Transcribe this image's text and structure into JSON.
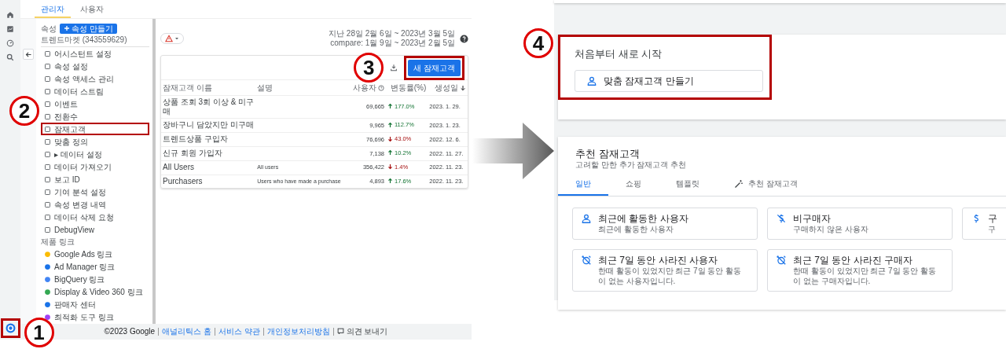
{
  "left": {
    "rail": {
      "settings_highlighted": true,
      "callout": "1"
    },
    "tabs": [
      {
        "label": "관리자",
        "selected": true
      },
      {
        "label": "사용자",
        "selected": false
      }
    ],
    "property": {
      "label": "속성",
      "create_button": "속성 만들기",
      "name": "트렌드마켓 (343559629)"
    },
    "sidebar": {
      "items": [
        {
          "label": "어시스턴트 설정",
          "highlighted": false
        },
        {
          "label": "속성 설정",
          "highlighted": false
        },
        {
          "label": "속성 액세스 관리",
          "highlighted": false
        },
        {
          "label": "데이터 스트림",
          "highlighted": false
        },
        {
          "label": "이벤트",
          "highlighted": false
        },
        {
          "label": "전환수",
          "highlighted": false
        },
        {
          "label": "잠재고객",
          "highlighted": true,
          "callout": "2"
        },
        {
          "label": "맞춤 정의",
          "highlighted": false
        },
        {
          "label": "▸ 데이터 설정",
          "highlighted": false
        },
        {
          "label": "데이터 가져오기",
          "highlighted": false
        },
        {
          "label": "보고 ID",
          "highlighted": false
        },
        {
          "label": "기여 분석 설정",
          "highlighted": false
        },
        {
          "label": "속성 변경 내역",
          "highlighted": false
        },
        {
          "label": "데이터 삭제 요청",
          "highlighted": false
        },
        {
          "label": "DebugView",
          "highlighted": false
        }
      ],
      "section": "제품 링크",
      "links": [
        "Google Ads 링크",
        "Ad Manager 링크",
        "BigQuery 링크",
        "Display & Video 360 링크",
        "판매자 센터",
        "최적화 도구 링크"
      ]
    },
    "date_range": {
      "line1": "지난 28일 2월 6일 ~ 2023년 3월 5일",
      "line2": "compare: 1월 9일 ~ 2023년 2월 5일"
    },
    "new_button": {
      "label": "새 잠재고객",
      "highlighted": true,
      "callout": "3"
    },
    "table": {
      "columns": [
        "잠재고객 이름",
        "설명",
        "사용자",
        "변동률(%)",
        "생성일"
      ],
      "rows": [
        {
          "name": "상품 조회 3회 이상 & 미구매",
          "users": "69,665",
          "rising": true,
          "change": "177.0%",
          "created": "2023. 1. 29."
        },
        {
          "name": "장바구니 담았지만 미구매",
          "users": "9,965",
          "rising": true,
          "change": "112.7%",
          "created": "2023. 1. 23."
        },
        {
          "name": "트렌드상품 구입자",
          "users": "76,696",
          "rising": false,
          "change": "43.0%",
          "created": "2022. 12. 6."
        },
        {
          "name": "신규 회원 가입자",
          "users": "7,138",
          "rising": true,
          "change": "10.2%",
          "created": "2022. 11. 27."
        },
        {
          "name": "All Users",
          "description": "All users",
          "users": "356,422",
          "rising": false,
          "change": "1.4%",
          "created": "2022. 11. 23."
        },
        {
          "name": "Purchasers",
          "description": "Users who have made a purchase",
          "users": "4,893",
          "rising": true,
          "change": "17.6%",
          "created": "2022. 11. 23."
        }
      ]
    },
    "footer": {
      "copyright": "©2023 Google",
      "links": [
        "애널리틱스 홈",
        "서비스 약관",
        "개인정보처리방침"
      ],
      "feedback": "의견 보내기"
    }
  },
  "right": {
    "start": {
      "title": "처음부터 새로 시작",
      "button": "맞춤 잠재고객 만들기",
      "highlighted": true,
      "callout": "4"
    },
    "suggested": {
      "title": "추천 잠재고객",
      "subtitle": "고려할 만한 추가 잠재고객 추천",
      "tabs": [
        {
          "label": "일반",
          "selected": true,
          "kind": "plain"
        },
        {
          "label": "쇼핑",
          "selected": false,
          "kind": "plain"
        },
        {
          "label": "템플릿",
          "selected": false,
          "kind": "plain"
        },
        {
          "label": "추천 잠재고객",
          "selected": false,
          "kind": "magic"
        }
      ],
      "cards": [
        {
          "kind": "person",
          "title": "최근에 활동한 사용자",
          "description": "최근에 활동한 사용자"
        },
        {
          "kind": "no-money",
          "title": "비구매자",
          "description": "구매하지 않은 사용자"
        },
        {
          "kind": "money",
          "title": "구",
          "description": "구"
        },
        {
          "kind": "clock-off",
          "title": "최근 7일 동안 사라진 사용자",
          "description": "한때 활동이 있었지만 최근 7일 동안 활동이 없는 사용자입니다."
        },
        {
          "kind": "clock-off",
          "title": "최근 7일 동안 사라진 구매자",
          "description": "한때 활동이 있었지만 최근 7일 동안 활동이 없는 구매자입니다."
        }
      ]
    }
  }
}
